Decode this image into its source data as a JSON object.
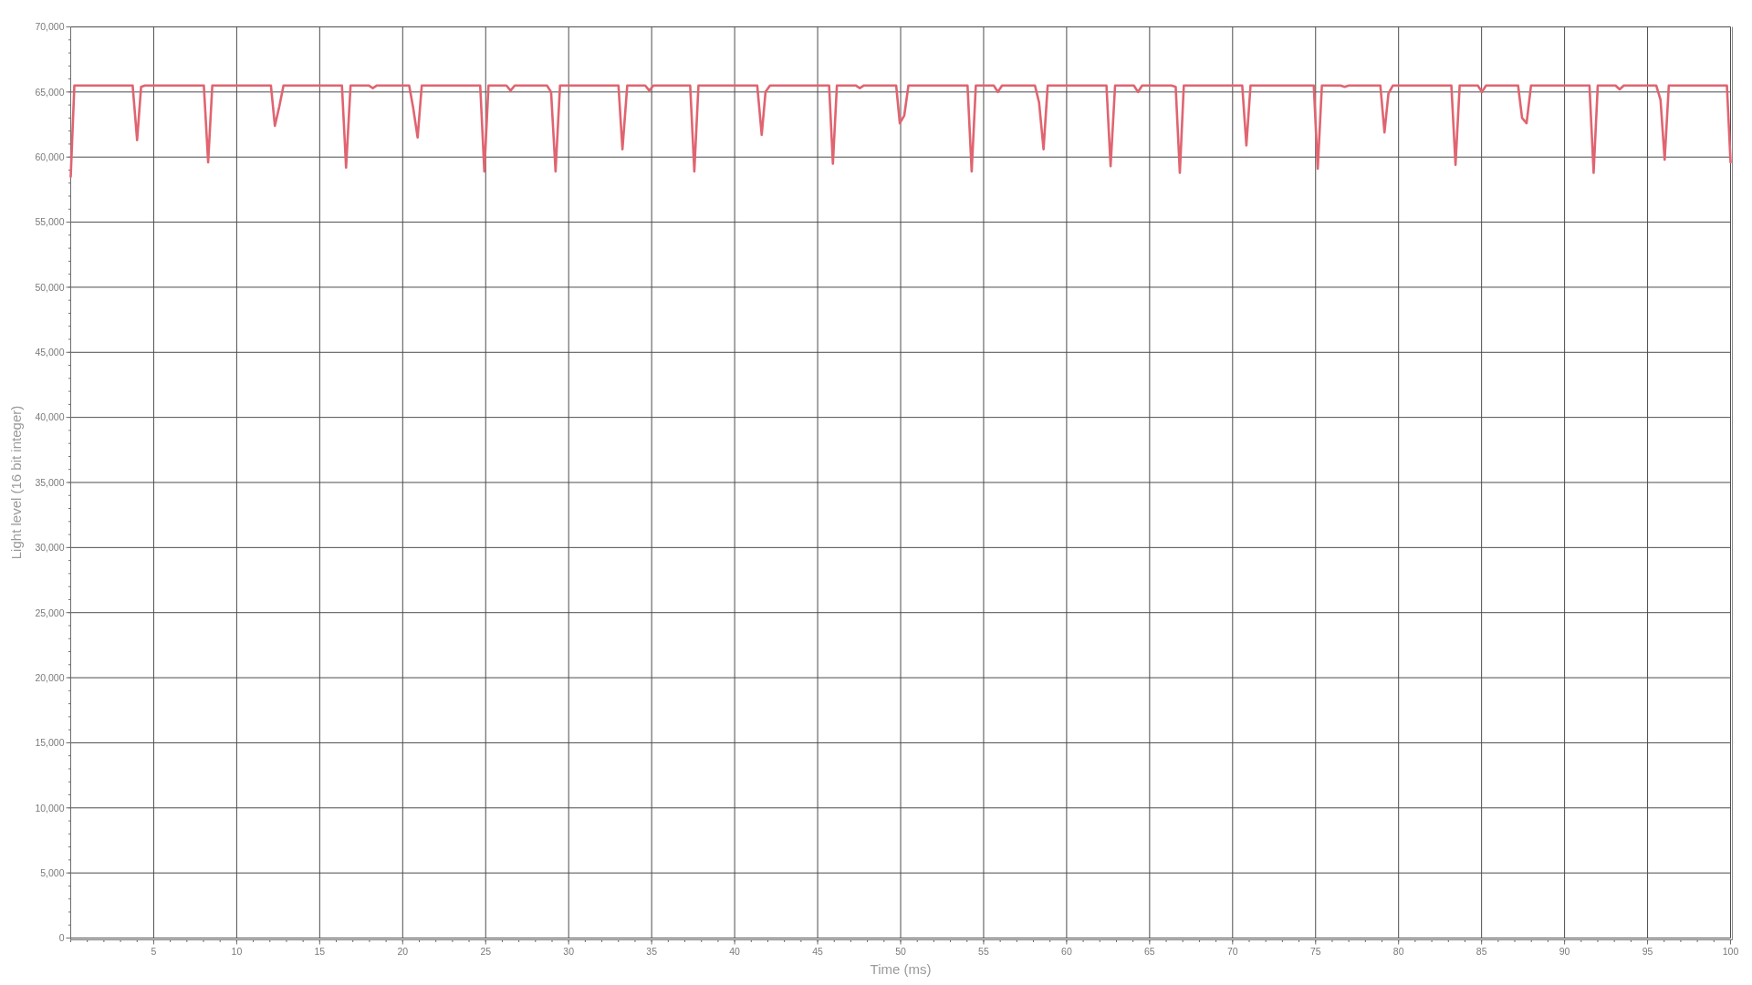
{
  "chart": {
    "chart_data": {
      "type": "line",
      "xlabel": "Time (ms)",
      "ylabel": "Light level (16 bit integer)",
      "grid": true,
      "x": [
        0,
        0.22,
        3.73,
        4.0,
        4.24,
        4.47,
        8.02,
        8.28,
        8.53,
        12.06,
        12.3,
        12.57,
        12.82,
        16.34,
        16.59,
        16.86,
        17.95,
        18.2,
        18.45,
        20.39,
        20.63,
        20.9,
        21.15,
        24.67,
        24.92,
        25.17,
        26.25,
        26.5,
        26.75,
        28.69,
        28.94,
        29.21,
        29.48,
        33.0,
        33.24,
        33.53,
        34.61,
        34.86,
        35.11,
        37.32,
        37.57,
        37.82,
        41.36,
        41.63,
        41.86,
        42.13,
        45.69,
        45.92,
        46.16,
        47.29,
        47.54,
        47.79,
        49.73,
        49.95,
        50.22,
        50.47,
        54.03,
        54.28,
        54.53,
        55.61,
        55.86,
        56.11,
        58.09,
        58.34,
        58.61,
        58.86,
        62.4,
        62.65,
        62.92,
        64.05,
        64.3,
        64.55,
        66.32,
        66.57,
        66.82,
        67.06,
        70.58,
        70.83,
        71.08,
        74.89,
        75.13,
        75.38,
        76.5,
        76.75,
        77.0,
        78.9,
        79.15,
        79.39,
        79.66,
        83.18,
        83.43,
        83.68,
        84.77,
        85.02,
        85.27,
        87.2,
        87.44,
        87.71,
        87.98,
        91.5,
        91.75,
        92.0,
        93.07,
        93.32,
        93.57,
        95.52,
        95.78,
        96.03,
        96.28,
        99.78,
        100
      ],
      "values": [
        58500,
        65500,
        65500,
        61300,
        65400,
        65500,
        65500,
        59600,
        65500,
        65500,
        62400,
        63900,
        65500,
        65500,
        59200,
        65500,
        65500,
        65300,
        65500,
        65500,
        63800,
        61500,
        65500,
        65500,
        58900,
        65500,
        65500,
        65100,
        65500,
        65500,
        65000,
        58900,
        65500,
        65500,
        60600,
        65500,
        65500,
        65100,
        65500,
        65500,
        58900,
        65500,
        65500,
        61700,
        65000,
        65500,
        65500,
        59500,
        65500,
        65500,
        65300,
        65500,
        65500,
        62600,
        63200,
        65500,
        65500,
        58900,
        65500,
        65500,
        65000,
        65500,
        65500,
        64200,
        60600,
        65500,
        65500,
        59300,
        65500,
        65500,
        65000,
        65500,
        65500,
        65400,
        58800,
        65500,
        65500,
        60900,
        65500,
        65500,
        59100,
        65500,
        65500,
        65400,
        65500,
        65500,
        61900,
        64900,
        65500,
        65500,
        59400,
        65500,
        65500,
        65000,
        65500,
        65500,
        63000,
        62600,
        65500,
        65500,
        58800,
        65500,
        65500,
        65200,
        65500,
        65500,
        64400,
        59800,
        65500,
        65500,
        59600
      ],
      "xlim": [
        0,
        100
      ],
      "ylim": [
        0,
        70000
      ],
      "xticks": [
        5,
        10,
        15,
        20,
        25,
        30,
        35,
        40,
        45,
        50,
        55,
        60,
        65,
        70,
        75,
        80,
        85,
        90,
        95,
        100
      ],
      "yticks": [
        {
          "value": 0,
          "label": "0"
        },
        {
          "value": 5000,
          "label": "5,000"
        },
        {
          "value": 10000,
          "label": "10,000"
        },
        {
          "value": 15000,
          "label": "15,000"
        },
        {
          "value": 20000,
          "label": "20,000"
        },
        {
          "value": 25000,
          "label": "25,000"
        },
        {
          "value": 30000,
          "label": "30,000"
        },
        {
          "value": 35000,
          "label": "35,000"
        },
        {
          "value": 40000,
          "label": "40,000"
        },
        {
          "value": 45000,
          "label": "45,000"
        },
        {
          "value": 50000,
          "label": "50,000"
        },
        {
          "value": 55000,
          "label": "55,000"
        },
        {
          "value": 60000,
          "label": "60,000"
        },
        {
          "value": 65000,
          "label": "65,000"
        },
        {
          "value": 70000,
          "label": "70,000"
        }
      ]
    }
  }
}
